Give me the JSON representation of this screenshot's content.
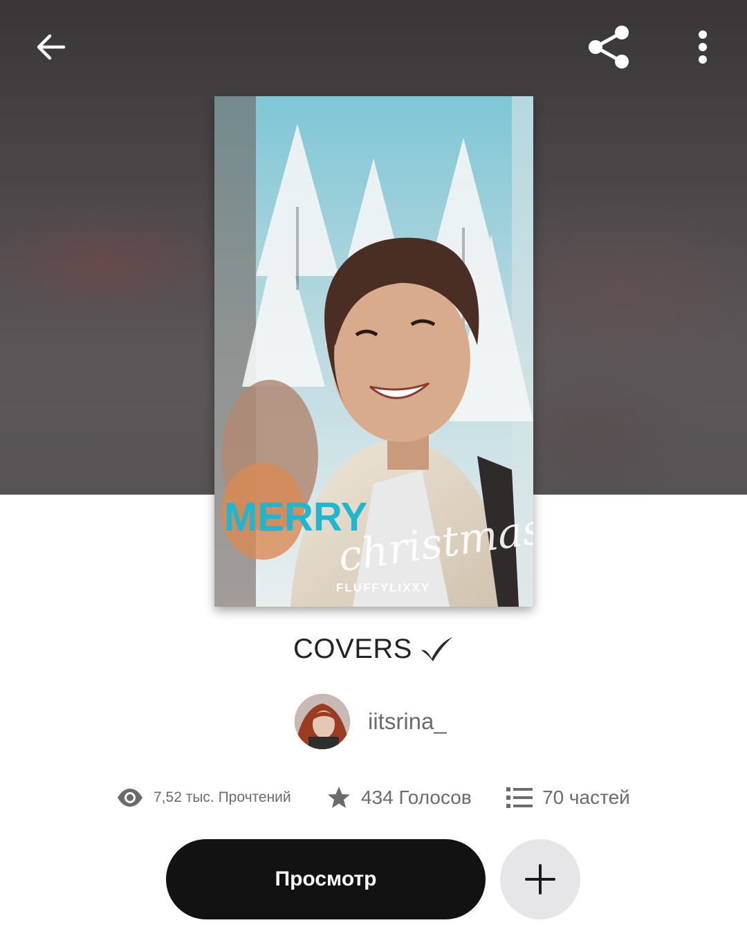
{
  "story": {
    "title": "COVERS",
    "title_mark": "✔",
    "cover": {
      "headline": "MERRY",
      "script_text": "christmas",
      "credit": "FLUFFYLIXXY"
    }
  },
  "author": {
    "username": "iitsrina_"
  },
  "stats": {
    "reads": "7,52 тыс. Прочтений",
    "votes": "434 Голосов",
    "parts": "70 частей"
  },
  "actions": {
    "read_label": "Просмотр"
  },
  "toolbar": {
    "back_icon": "arrow-left-icon",
    "share_icon": "share-icon",
    "more_icon": "more-vertical-icon"
  },
  "colors": {
    "accent_cyan": "#1fb6d0",
    "button_dark": "#121212",
    "add_button_bg": "#e6e6e8",
    "muted_text": "#6b6b6b"
  }
}
